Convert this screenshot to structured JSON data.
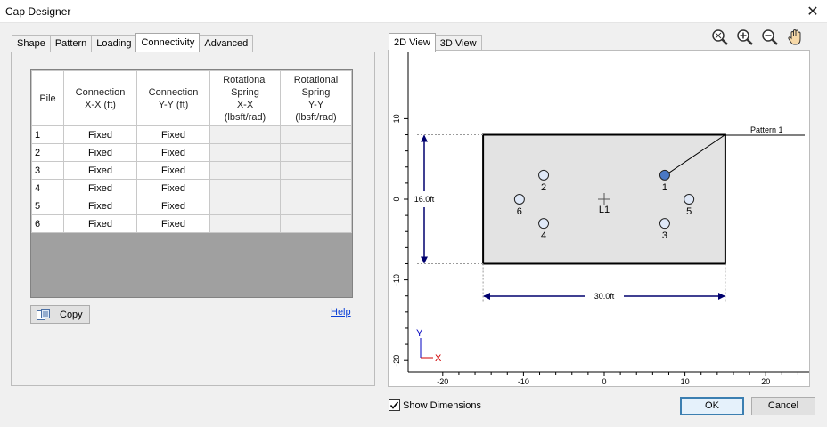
{
  "window": {
    "title": "Cap Designer",
    "close_glyph": "✕"
  },
  "left_tabs": [
    {
      "label": "Shape"
    },
    {
      "label": "Pattern"
    },
    {
      "label": "Loading"
    },
    {
      "label": "Connectivity"
    },
    {
      "label": "Advanced"
    }
  ],
  "table": {
    "headers": [
      "Pile",
      "Connection\nX-X (ft)",
      "Connection\nY-Y (ft)",
      "Rotational\nSpring\nX-X\n(lbsft/rad)",
      "Rotational\nSpring\nY-Y\n(lbsft/rad)"
    ],
    "rows": [
      {
        "pile": "1",
        "cx": "Fixed",
        "cy": "Fixed",
        "rx": "",
        "ry": ""
      },
      {
        "pile": "2",
        "cx": "Fixed",
        "cy": "Fixed",
        "rx": "",
        "ry": ""
      },
      {
        "pile": "3",
        "cx": "Fixed",
        "cy": "Fixed",
        "rx": "",
        "ry": ""
      },
      {
        "pile": "4",
        "cx": "Fixed",
        "cy": "Fixed",
        "rx": "",
        "ry": ""
      },
      {
        "pile": "5",
        "cx": "Fixed",
        "cy": "Fixed",
        "rx": "",
        "ry": ""
      },
      {
        "pile": "6",
        "cx": "Fixed",
        "cy": "Fixed",
        "rx": "",
        "ry": ""
      }
    ]
  },
  "copy_button": {
    "label": "Copy",
    "icon": "copy-icon"
  },
  "help_link": {
    "label": "Help"
  },
  "view_tabs": [
    {
      "label": "2D View"
    },
    {
      "label": "3D View"
    }
  ],
  "view_tools": [
    {
      "icon": "zoom-fit-icon"
    },
    {
      "icon": "zoom-in-icon"
    },
    {
      "icon": "zoom-out-icon"
    },
    {
      "icon": "pan-hand-icon"
    }
  ],
  "plot": {
    "x_ticks": [
      "-20",
      "-10",
      "0",
      "10",
      "20"
    ],
    "y_ticks": [
      "10",
      "0",
      "-10",
      "-20"
    ],
    "pattern_label": "Pattern 1",
    "width_dim": "30.0ft",
    "height_dim": "16.0ft",
    "load_label": "L1",
    "axis_x": "X",
    "axis_y": "Y",
    "piles": [
      {
        "label": "1",
        "x": 7.5,
        "y": 3.0,
        "selected": true
      },
      {
        "label": "2",
        "x": -7.5,
        "y": 3.0,
        "selected": false
      },
      {
        "label": "3",
        "x": 7.5,
        "y": -3.0,
        "selected": false
      },
      {
        "label": "4",
        "x": -7.5,
        "y": -3.0,
        "selected": false
      },
      {
        "label": "5",
        "x": 10.5,
        "y": 0.0,
        "selected": false
      },
      {
        "label": "6",
        "x": -10.5,
        "y": 0.0,
        "selected": false
      }
    ],
    "colors": {
      "cap_fill": "#e3e3e3",
      "pile_fill": "#dfe8f7",
      "pile_selected": "#4a78c4",
      "dim": "#00006e",
      "axis_y": "#0000c0",
      "axis_x": "#d00000"
    }
  },
  "show_dimensions": {
    "label": "Show Dimensions",
    "checked": true
  },
  "ok_button": {
    "label": "OK"
  },
  "cancel_button": {
    "label": "Cancel"
  }
}
